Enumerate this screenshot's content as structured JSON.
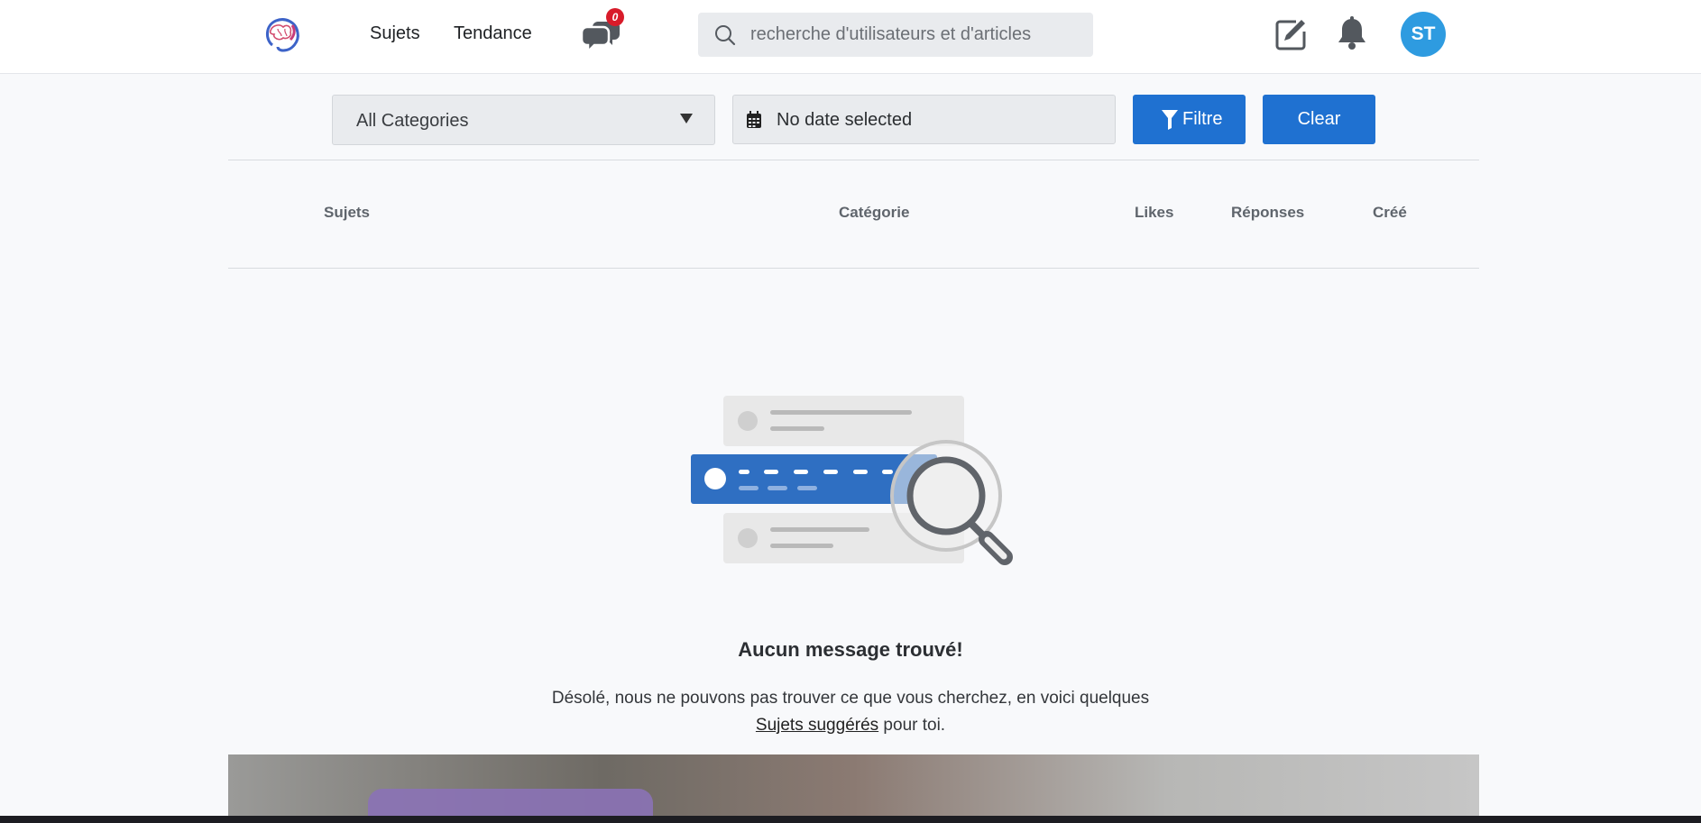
{
  "header": {
    "nav": {
      "sujets": "Sujets",
      "tendance": "Tendance"
    },
    "chat_badge": "0",
    "search": {
      "placeholder": "recherche d'utilisateurs et d'articles"
    },
    "avatar_initials": "ST",
    "icons": {
      "logo": "brain-logo-icon",
      "chat": "chat-bubbles-icon",
      "search": "search-icon",
      "edit": "edit-icon",
      "bell": "bell-icon"
    }
  },
  "filters": {
    "category": "All Categories",
    "date": "No date selected",
    "filter_button": "Filtre",
    "clear_button": "Clear"
  },
  "table": {
    "columns": [
      "Sujets",
      "Catégorie",
      "Likes",
      "Réponses",
      "Créé"
    ]
  },
  "empty_state": {
    "title": "Aucun message trouvé!",
    "text_before": "Désolé, nous ne pouvons pas trouver ce que vous cherchez, en voici quelques",
    "link": "Sujets suggérés",
    "text_after": " pour toi."
  },
  "colors": {
    "primary": "#1f71d1",
    "badge": "#d81b2a",
    "avatar": "#2e9be0"
  }
}
